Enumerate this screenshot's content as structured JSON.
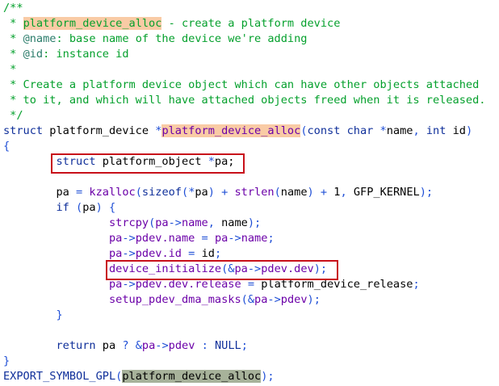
{
  "code": {
    "lines": [
      [
        {
          "t": "/**",
          "c": "c"
        }
      ],
      [
        {
          "t": " * ",
          "c": "c"
        },
        {
          "t": "platform_device_alloc",
          "c": "c hl-orange"
        },
        {
          "t": " - create a platform device",
          "c": "c"
        }
      ],
      [
        {
          "t": " * ",
          "c": "c"
        },
        {
          "t": "@name",
          "c": "t"
        },
        {
          "t": ": base name of the device we're adding",
          "c": "c"
        }
      ],
      [
        {
          "t": " * ",
          "c": "c"
        },
        {
          "t": "@id",
          "c": "t"
        },
        {
          "t": ": instance id",
          "c": "c"
        }
      ],
      [
        {
          "t": " *",
          "c": "c"
        }
      ],
      [
        {
          "t": " * Create a platform device object which can have other objects attached",
          "c": "c"
        }
      ],
      [
        {
          "t": " * to it, and which will have attached objects freed when it is released.",
          "c": "c"
        }
      ],
      [
        {
          "t": " */",
          "c": "c"
        }
      ],
      [
        {
          "t": "struct",
          "c": "k"
        },
        {
          "t": " platform_device ",
          "c": "n"
        },
        {
          "t": "*",
          "c": "p"
        },
        {
          "t": "platform_device_alloc",
          "c": "f hl-orange"
        },
        {
          "t": "(",
          "c": "p"
        },
        {
          "t": "const char",
          "c": "k"
        },
        {
          "t": " *",
          "c": "p"
        },
        {
          "t": "name",
          "c": "n"
        },
        {
          "t": ", ",
          "c": "p"
        },
        {
          "t": "int",
          "c": "k"
        },
        {
          "t": " id",
          "c": "n"
        },
        {
          "t": ")",
          "c": "p"
        }
      ],
      [
        {
          "t": "{",
          "c": "p"
        }
      ],
      [
        {
          "t": "        ",
          "c": "n"
        },
        {
          "t": "struct",
          "c": "k"
        },
        {
          "t": " platform_object ",
          "c": "n"
        },
        {
          "t": "*",
          "c": "p"
        },
        {
          "t": "pa;",
          "c": "n"
        }
      ],
      [
        {
          "t": "",
          "c": "n"
        }
      ],
      [
        {
          "t": "        pa ",
          "c": "n"
        },
        {
          "t": "=",
          "c": "p"
        },
        {
          "t": " ",
          "c": "n"
        },
        {
          "t": "kzalloc",
          "c": "f"
        },
        {
          "t": "(",
          "c": "p"
        },
        {
          "t": "sizeof",
          "c": "k"
        },
        {
          "t": "(",
          "c": "p"
        },
        {
          "t": "*",
          "c": "p"
        },
        {
          "t": "pa",
          "c": "n"
        },
        {
          "t": ") + ",
          "c": "p"
        },
        {
          "t": "strlen",
          "c": "f"
        },
        {
          "t": "(",
          "c": "p"
        },
        {
          "t": "name",
          "c": "n"
        },
        {
          "t": ") + ",
          "c": "p"
        },
        {
          "t": "1",
          "c": "n"
        },
        {
          "t": ", ",
          "c": "p"
        },
        {
          "t": "GFP_KERNEL",
          "c": "n"
        },
        {
          "t": ");",
          "c": "p"
        }
      ],
      [
        {
          "t": "        ",
          "c": "n"
        },
        {
          "t": "if",
          "c": "k"
        },
        {
          "t": " (",
          "c": "p"
        },
        {
          "t": "pa",
          "c": "n"
        },
        {
          "t": ") {",
          "c": "p"
        }
      ],
      [
        {
          "t": "                ",
          "c": "n"
        },
        {
          "t": "strcpy",
          "c": "f"
        },
        {
          "t": "(",
          "c": "p"
        },
        {
          "t": "pa",
          "c": "f"
        },
        {
          "t": "->",
          "c": "p"
        },
        {
          "t": "name",
          "c": "f"
        },
        {
          "t": ", ",
          "c": "p"
        },
        {
          "t": "name",
          "c": "n"
        },
        {
          "t": ");",
          "c": "p"
        }
      ],
      [
        {
          "t": "                ",
          "c": "n"
        },
        {
          "t": "pa",
          "c": "f"
        },
        {
          "t": "->",
          "c": "p"
        },
        {
          "t": "pdev.name",
          "c": "f"
        },
        {
          "t": " = ",
          "c": "p"
        },
        {
          "t": "pa",
          "c": "f"
        },
        {
          "t": "->",
          "c": "p"
        },
        {
          "t": "name",
          "c": "f"
        },
        {
          "t": ";",
          "c": "p"
        }
      ],
      [
        {
          "t": "                ",
          "c": "n"
        },
        {
          "t": "pa",
          "c": "f"
        },
        {
          "t": "->",
          "c": "p"
        },
        {
          "t": "pdev.id",
          "c": "f"
        },
        {
          "t": " = ",
          "c": "p"
        },
        {
          "t": "id",
          "c": "n"
        },
        {
          "t": ";",
          "c": "p"
        }
      ],
      [
        {
          "t": "                ",
          "c": "n"
        },
        {
          "t": "device_initialize",
          "c": "f"
        },
        {
          "t": "(&",
          "c": "p"
        },
        {
          "t": "pa",
          "c": "f"
        },
        {
          "t": "->",
          "c": "p"
        },
        {
          "t": "pdev.dev",
          "c": "f"
        },
        {
          "t": ");",
          "c": "p"
        }
      ],
      [
        {
          "t": "                ",
          "c": "n"
        },
        {
          "t": "pa",
          "c": "f"
        },
        {
          "t": "->",
          "c": "p"
        },
        {
          "t": "pdev.dev.release",
          "c": "f"
        },
        {
          "t": " = ",
          "c": "p"
        },
        {
          "t": "platform_device_release",
          "c": "n"
        },
        {
          "t": ";",
          "c": "p"
        }
      ],
      [
        {
          "t": "                ",
          "c": "n"
        },
        {
          "t": "setup_pdev_dma_masks",
          "c": "f"
        },
        {
          "t": "(&",
          "c": "p"
        },
        {
          "t": "pa",
          "c": "f"
        },
        {
          "t": "->",
          "c": "p"
        },
        {
          "t": "pdev",
          "c": "f"
        },
        {
          "t": ");",
          "c": "p"
        }
      ],
      [
        {
          "t": "        ",
          "c": "n"
        },
        {
          "t": "}",
          "c": "p"
        }
      ],
      [
        {
          "t": "",
          "c": "n"
        }
      ],
      [
        {
          "t": "        ",
          "c": "n"
        },
        {
          "t": "return",
          "c": "k"
        },
        {
          "t": " pa ",
          "c": "n"
        },
        {
          "t": "? &",
          "c": "p"
        },
        {
          "t": "pa",
          "c": "f"
        },
        {
          "t": "->",
          "c": "p"
        },
        {
          "t": "pdev",
          "c": "f"
        },
        {
          "t": " : ",
          "c": "p"
        },
        {
          "t": "NULL",
          "c": "k"
        },
        {
          "t": ";",
          "c": "p"
        }
      ],
      [
        {
          "t": "}",
          "c": "p"
        }
      ],
      [
        {
          "t": "EXPORT_SYMBOL_GPL",
          "c": "m"
        },
        {
          "t": "(",
          "c": "p"
        },
        {
          "t": "platform_device_alloc",
          "c": "n hl-gray"
        },
        {
          "t": ");",
          "c": "p"
        }
      ]
    ]
  },
  "colors": {
    "highlight_box": "#c8101a",
    "highlight_orange": "#f9cba5",
    "highlight_gray": "#a7b29a"
  }
}
